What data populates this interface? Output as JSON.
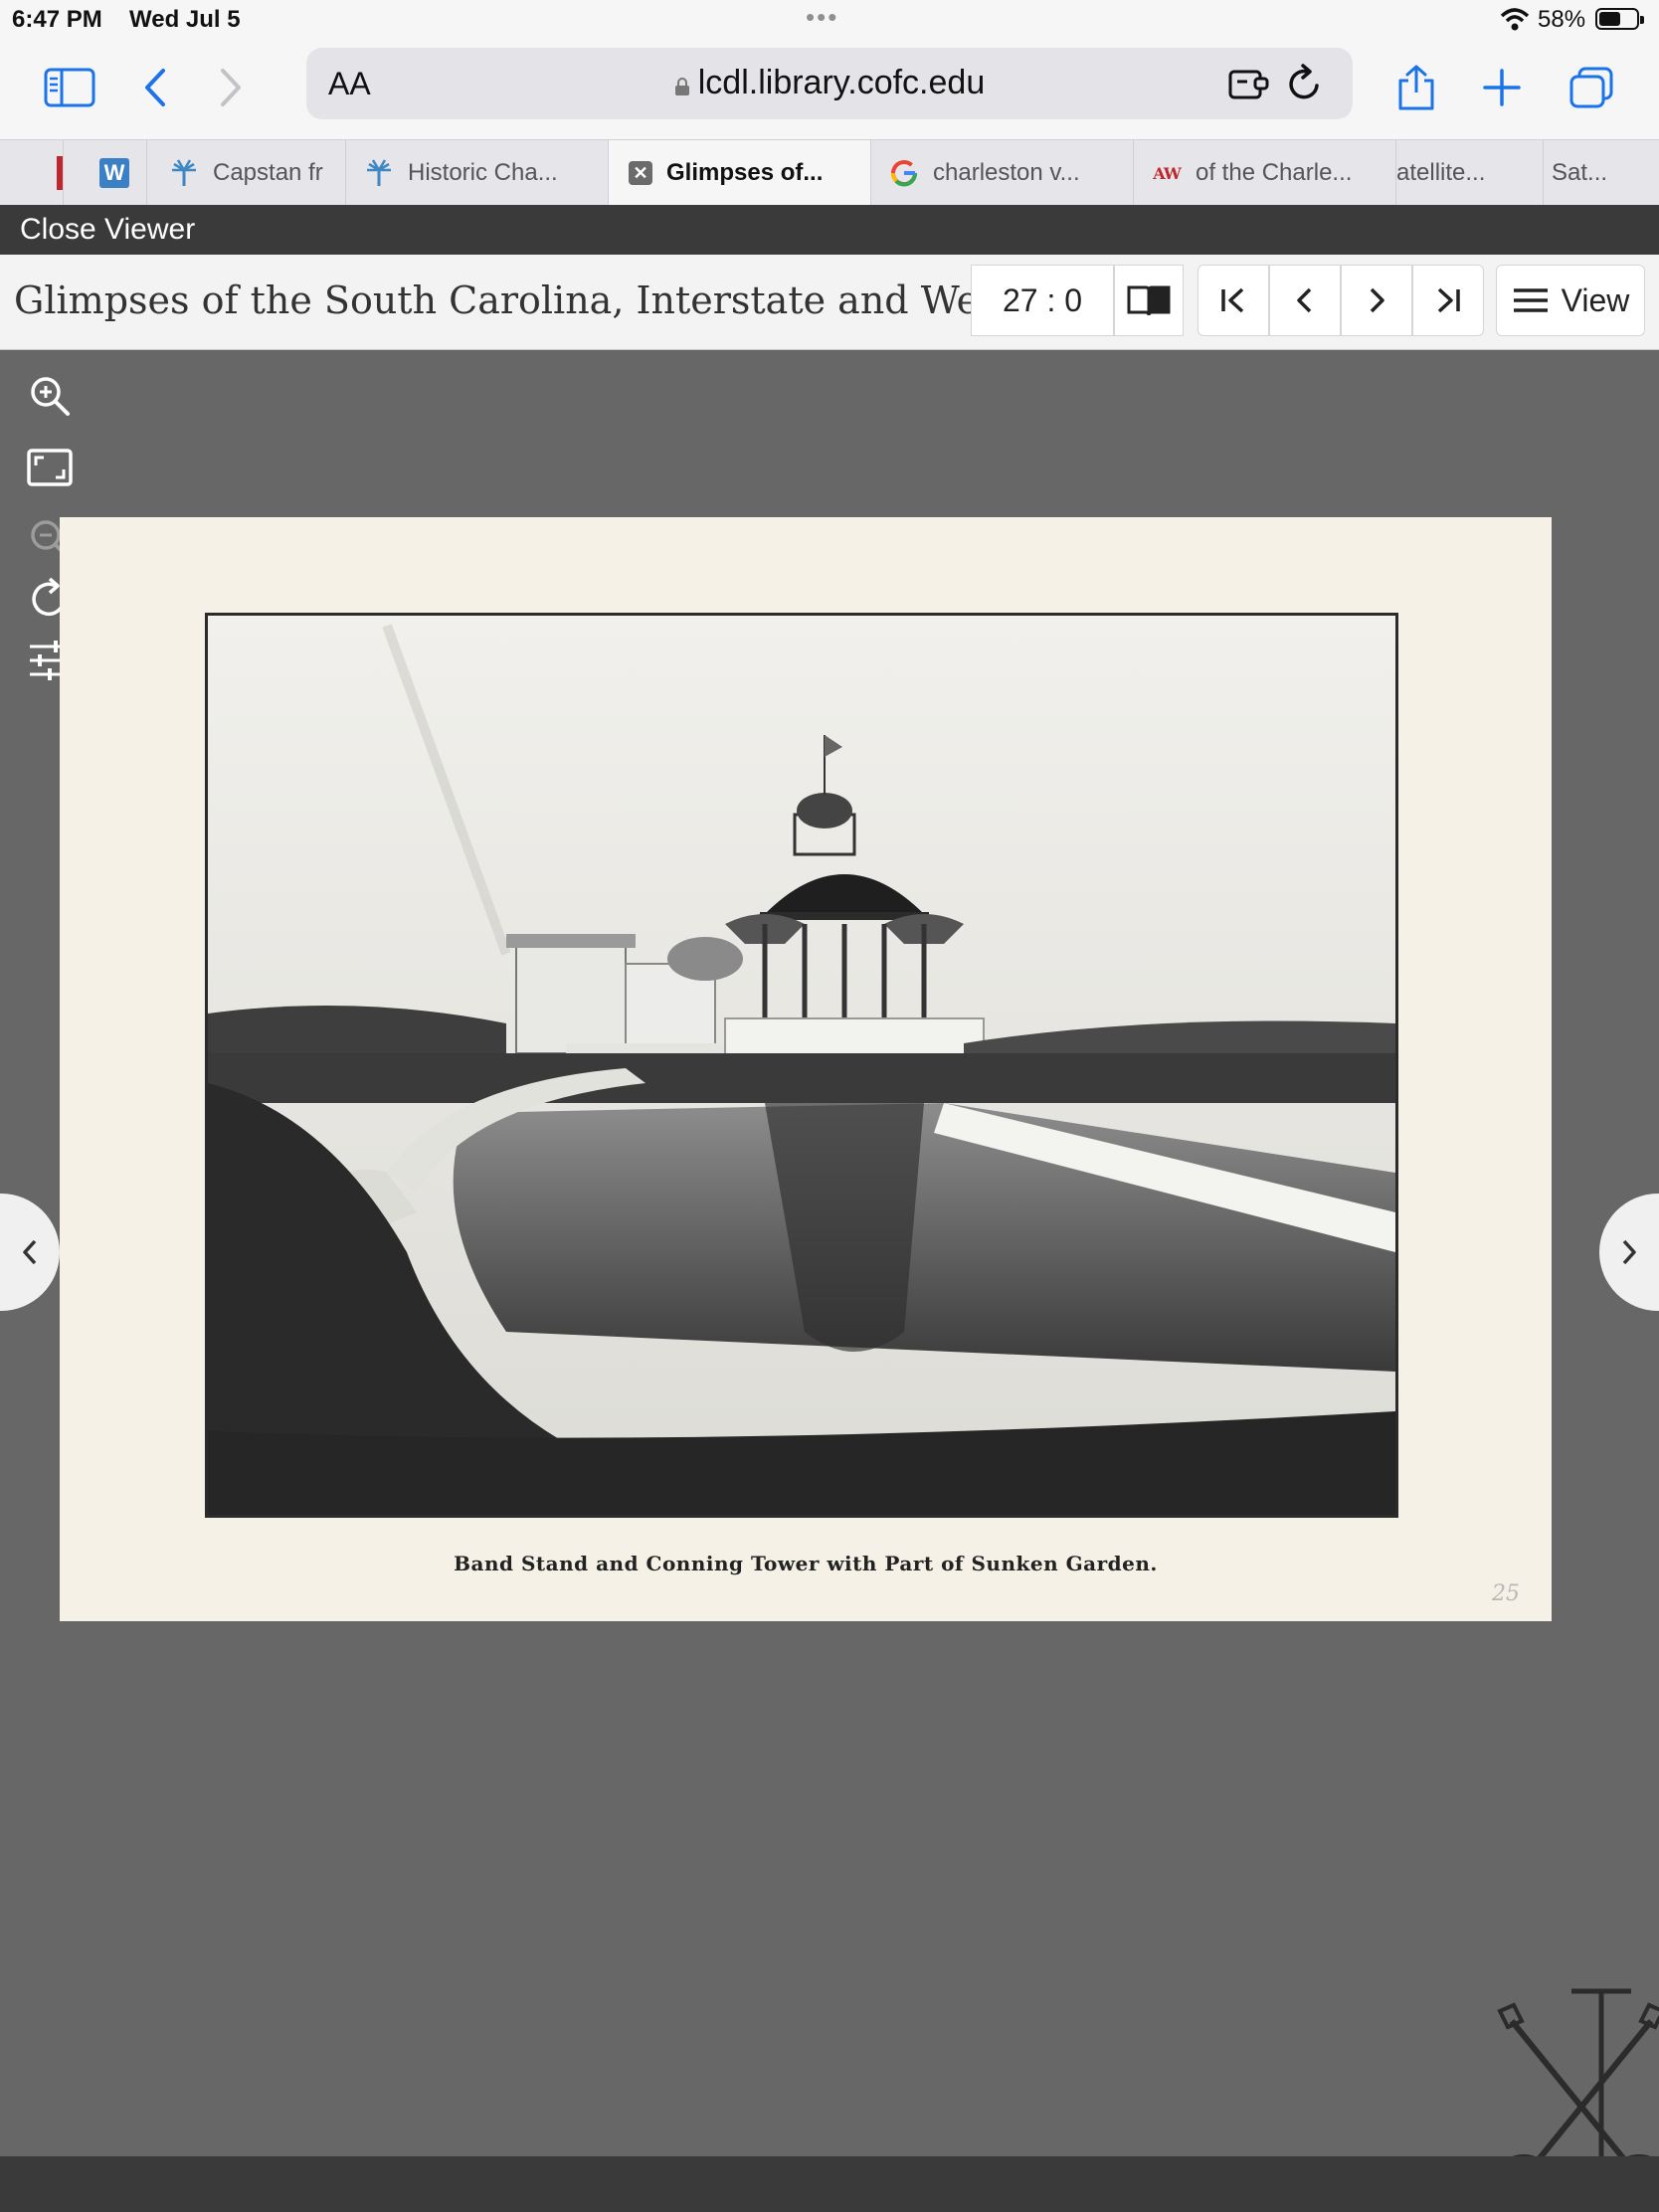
{
  "status": {
    "time": "6:47 PM",
    "date": "Wed Jul 5",
    "battery_pct": "58%",
    "battery_level": 0.58
  },
  "browser": {
    "text_size_label": "AA",
    "url": "lcdl.library.cofc.edu"
  },
  "tabs": [
    {
      "label": "",
      "icon": "red-bookmark-icon"
    },
    {
      "label": "",
      "icon": "wordpress-icon"
    },
    {
      "label": "Capstan fr",
      "icon": "palmetto-icon"
    },
    {
      "label": "Historic Cha...",
      "icon": "palmetto-icon"
    },
    {
      "label": "Glimpses of...",
      "icon": "close-tab-icon",
      "active": true
    },
    {
      "label": "charleston v...",
      "icon": "google-icon"
    },
    {
      "label": "of the Charle...",
      "icon": "aw-icon"
    },
    {
      "label": "atellite...",
      "icon": ""
    },
    {
      "label": "Sat...",
      "icon": ""
    }
  ],
  "viewer": {
    "close_label": "Close Viewer",
    "title": "Glimpses of the South Carolina, Interstate and Wes...",
    "page_indicator": "27 : 0",
    "view_label": "View"
  },
  "page": {
    "caption": "Band Stand and Conning Tower with Part of Sunken Garden.",
    "page_number": "25"
  },
  "colors": {
    "accent": "#1a73e8",
    "viewer_dark": "#3a3a3a",
    "stage_gray": "#676767",
    "paper": "#f5f1e6"
  }
}
